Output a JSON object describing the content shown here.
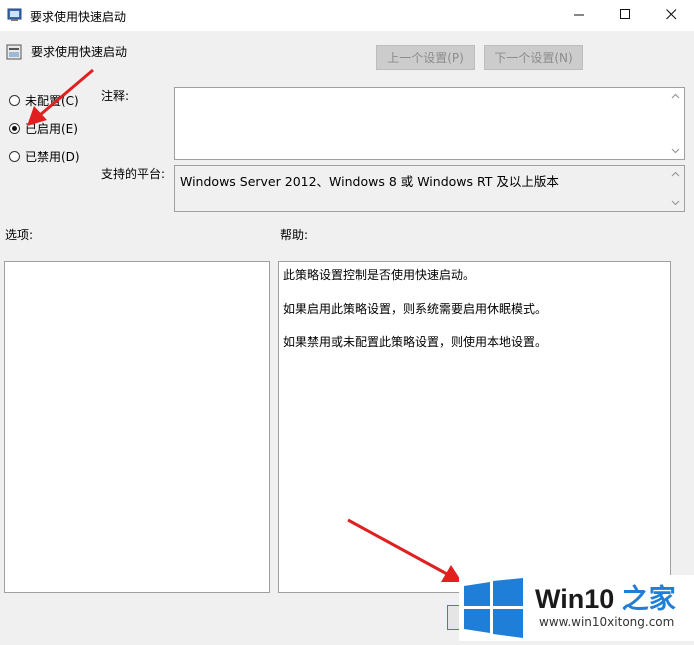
{
  "window": {
    "title": "要求使用快速启动",
    "minimize_glyph": "—",
    "maximize_glyph": "☐",
    "close_glyph": "✕"
  },
  "header": {
    "policy_title": "要求使用快速启动",
    "prev_label": "上一个设置(P)",
    "next_label": "下一个设置(N)"
  },
  "state": {
    "options": [
      {
        "label": "未配置(C)",
        "selected": false
      },
      {
        "label": "已启用(E)",
        "selected": true
      },
      {
        "label": "已禁用(D)",
        "selected": false
      }
    ]
  },
  "labels": {
    "comment": "注释:",
    "platform": "支持的平台:",
    "options": "选项:",
    "help": "帮助:"
  },
  "comment_value": "",
  "platform_value": "Windows Server 2012、Windows 8 或 Windows RT 及以上版本",
  "help_lines": [
    "此策略设置控制是否使用快速启动。",
    "如果启用此策略设置，则系统需要启用休眠模式。",
    "如果禁用或未配置此策略设置，则使用本地设置。"
  ],
  "watermark": {
    "title": "Win10",
    "title_suffix": "之家",
    "url": "www.win10xitong.com"
  },
  "colors": {
    "annotation_arrow": "#e02020",
    "watermark_blue": "#1f7fd8"
  },
  "icons": [
    "app-policy-icon",
    "minimize-icon",
    "maximize-icon",
    "close-icon",
    "scroll-up-icon",
    "scroll-down-icon",
    "windows-logo-icon"
  ]
}
